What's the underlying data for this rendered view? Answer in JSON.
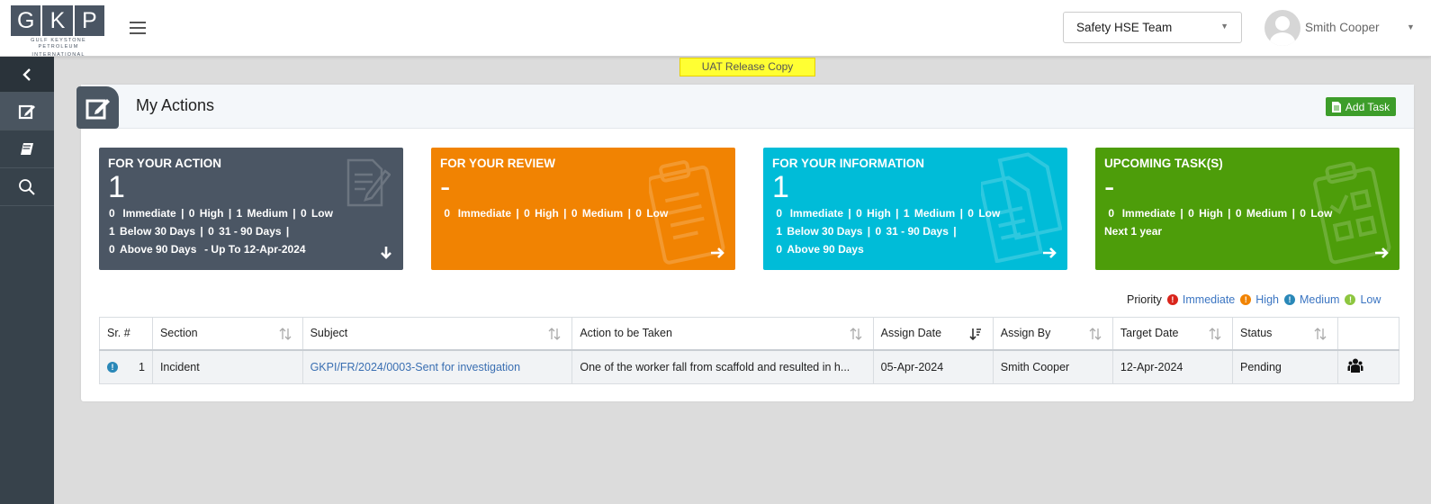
{
  "header": {
    "logo_letters": [
      "G",
      "K",
      "P"
    ],
    "logo_sub_1": "GULF KEYSTONE PETROLEUM",
    "logo_sub_2": "INTERNATIONAL",
    "team": "Safety HSE Team",
    "user": "Smith Cooper"
  },
  "banner": "UAT Release Copy",
  "panel": {
    "title": "My Actions",
    "add_task": "Add Task"
  },
  "cards": {
    "action": {
      "title": "FOR YOUR ACTION",
      "count": "1",
      "line1": [
        "0",
        "Immediate",
        "|",
        "0",
        "High",
        "|",
        "1",
        "Medium",
        "|",
        "0",
        "Low"
      ],
      "line2": [
        "1",
        "Below 30 Days",
        "|",
        "0",
        "31 - 90 Days",
        "|"
      ],
      "line3": [
        "0",
        "Above 90 Days",
        "- Up To 12-Apr-2024"
      ]
    },
    "review": {
      "title": "FOR YOUR REVIEW",
      "count": "-",
      "line1": [
        "0",
        "Immediate",
        "|",
        "0",
        "High",
        "|",
        "0",
        "Medium",
        "|",
        "0",
        "Low"
      ]
    },
    "info": {
      "title": "FOR YOUR INFORMATION",
      "count": "1",
      "line1": [
        "0",
        "Immediate",
        "|",
        "0",
        "High",
        "|",
        "1",
        "Medium",
        "|",
        "0",
        "Low"
      ],
      "line2": [
        "1",
        "Below 30 Days",
        "|",
        "0",
        "31 - 90 Days",
        "|"
      ],
      "line3": [
        "0",
        "Above 90 Days"
      ]
    },
    "upcoming": {
      "title": "UPCOMING TASK(S)",
      "count": "-",
      "line1": [
        "0",
        "Immediate",
        "|",
        "0",
        "High",
        "|",
        "0",
        "Medium",
        "|",
        "0",
        "Low"
      ],
      "line2": "Next 1 year"
    }
  },
  "priority": {
    "label": "Priority",
    "items": [
      {
        "label": "Immediate",
        "color": "#d9241b"
      },
      {
        "label": "High",
        "color": "#f18302"
      },
      {
        "label": "Medium",
        "color": "#2a88b8"
      },
      {
        "label": "Low",
        "color": "#8dc63f"
      }
    ]
  },
  "table": {
    "columns": [
      "Sr. #",
      "Section",
      "Subject",
      "Action to be Taken",
      "Assign Date",
      "Assign By",
      "Target Date",
      "Status",
      ""
    ],
    "rows": [
      {
        "sr": "1",
        "section": "Incident",
        "subject": "GKPI/FR/2024/0003-Sent for investigation",
        "action": "One of the worker fall from scaffold and resulted in h...",
        "assign_date": "05-Apr-2024",
        "assign_by": "Smith Cooper",
        "target_date": "12-Apr-2024",
        "status": "Pending"
      }
    ]
  }
}
